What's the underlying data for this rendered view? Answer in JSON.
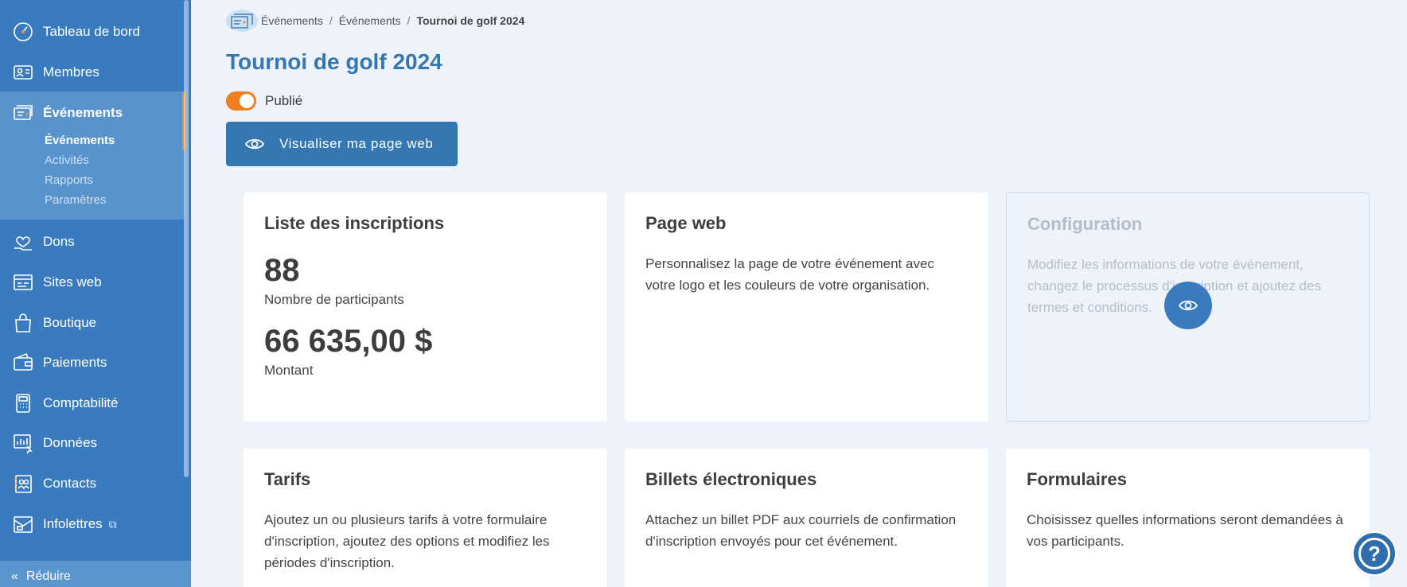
{
  "sidebar": {
    "items": [
      {
        "label": "Tableau de bord",
        "icon": "dashboard-icon"
      },
      {
        "label": "Membres",
        "icon": "members-icon"
      },
      {
        "label": "Événements",
        "icon": "events-icon"
      },
      {
        "label": "Dons",
        "icon": "donations-icon"
      },
      {
        "label": "Sites web",
        "icon": "website-icon"
      },
      {
        "label": "Boutique",
        "icon": "shop-bag-icon"
      },
      {
        "label": "Paiements",
        "icon": "wallet-icon"
      },
      {
        "label": "Comptabilité",
        "icon": "calculator-icon"
      },
      {
        "label": "Données",
        "icon": "data-icon"
      },
      {
        "label": "Contacts",
        "icon": "contacts-icon"
      },
      {
        "label": "Infolettres",
        "icon": "newsletter-icon"
      }
    ],
    "subitems": [
      "Événements",
      "Activités",
      "Rapports",
      "Paramètres"
    ],
    "collapse_label": "Réduire"
  },
  "breadcrumb": {
    "items": [
      "Événements",
      "Événements",
      "Tournoi de golf 2024"
    ],
    "separator": "/"
  },
  "page": {
    "title": "Tournoi de golf 2024",
    "published_label": "Publié",
    "published": true,
    "view_button_label": "Visualiser ma page web"
  },
  "cards": {
    "registrations": {
      "title": "Liste des inscriptions",
      "participants": "88",
      "participants_label": "Nombre de participants",
      "amount": "66 635,00 $",
      "amount_label": "Montant"
    },
    "webpage": {
      "title": "Page web",
      "text": "Personnalisez la page de votre événement avec votre logo et les couleurs de votre organisation."
    },
    "configuration": {
      "title": "Configuration",
      "text": "Modifiez les informations de votre événement, changez le processus d'inscription et ajoutez des termes et conditions."
    },
    "rates": {
      "title": "Tarifs",
      "text": "Ajoutez un ou plusieurs tarifs à votre formulaire d'inscription, ajoutez des options et modifiez les périodes d'inscription."
    },
    "tickets": {
      "title": "Billets électroniques",
      "text": "Attachez un billet PDF aux courriels de confirmation d'inscription envoyés pour cet événement."
    },
    "forms": {
      "title": "Formulaires",
      "text": "Choisissez quelles informations seront demandées à vos participants."
    }
  },
  "colors": {
    "sidebar": "#3a7bbf",
    "accent": "#f07f22",
    "primary": "#3577b3"
  }
}
